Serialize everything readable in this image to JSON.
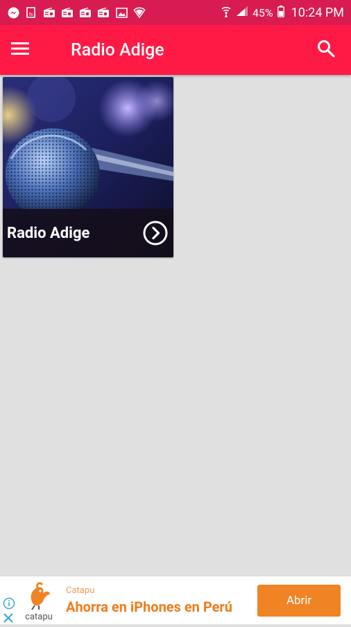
{
  "status_bar": {
    "battery": "45%",
    "time": "10:24 PM",
    "notification_icons": [
      "messenger-icon",
      "radio-icon",
      "radio-icon",
      "radio-icon",
      "radio-icon",
      "radio-icon",
      "image-icon",
      "shield-icon"
    ],
    "colors": {
      "background": "#d81b50"
    }
  },
  "app_bar": {
    "title": "Radio Adige",
    "menu_icon": "hamburger-menu-icon",
    "search_icon": "search-icon",
    "colors": {
      "background": "#ff1a45",
      "text": "#ffffff"
    }
  },
  "stations": [
    {
      "name": "Radio Adige",
      "action_icon": "chevron-right-circle-icon"
    }
  ],
  "ad": {
    "brand": "Catapu",
    "logo_text": "catapu",
    "headline": "Ahorra en iPhones en Perú",
    "cta": "Abrir",
    "colors": {
      "accent": "#f08323"
    }
  }
}
